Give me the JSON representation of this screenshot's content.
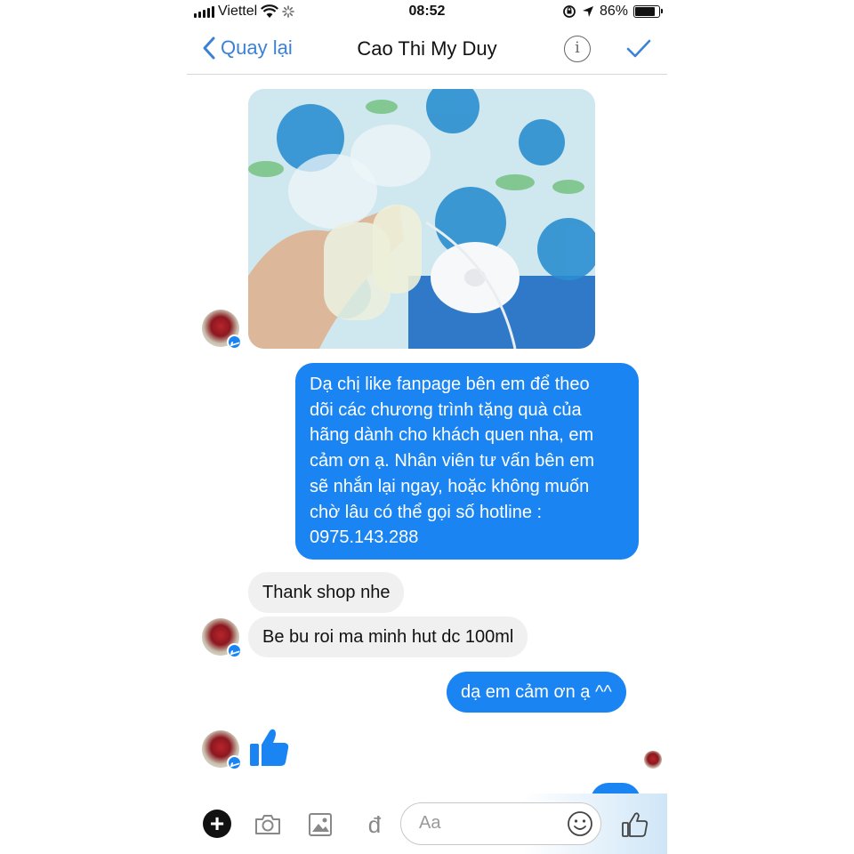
{
  "status_bar": {
    "carrier": "Viettel",
    "time": "08:52",
    "battery": "86%",
    "battery_level": 0.86
  },
  "nav": {
    "back_label": "Quay lại",
    "contact_name": "Cao Thi My Duy",
    "info_icon": "i"
  },
  "messages": {
    "outgoing_1": [
      "Dạ chị like fanpage bên em để theo",
      "dõi các chương trình tặng quà của",
      "hãng dành cho khách quen nha, em",
      "cảm ơn ạ. Nhân viên tư vấn bên em",
      "sẽ nhắn lại ngay, hoặc không muốn",
      "chờ lâu có thể gọi số hotline :",
      "0975.143.288"
    ],
    "incoming_1": "Thank shop nhe",
    "incoming_2": "Be bu roi ma minh hut dc 100ml",
    "outgoing_2": "dạ em cảm ơn ạ ^^"
  },
  "composer": {
    "plus": "+",
    "currency": "đ",
    "placeholder": "Aa"
  },
  "colors": {
    "messenger_blue": "#1a84f2",
    "nav_blue": "#3b82d6",
    "incoming_bubble": "#f0f0f0"
  }
}
